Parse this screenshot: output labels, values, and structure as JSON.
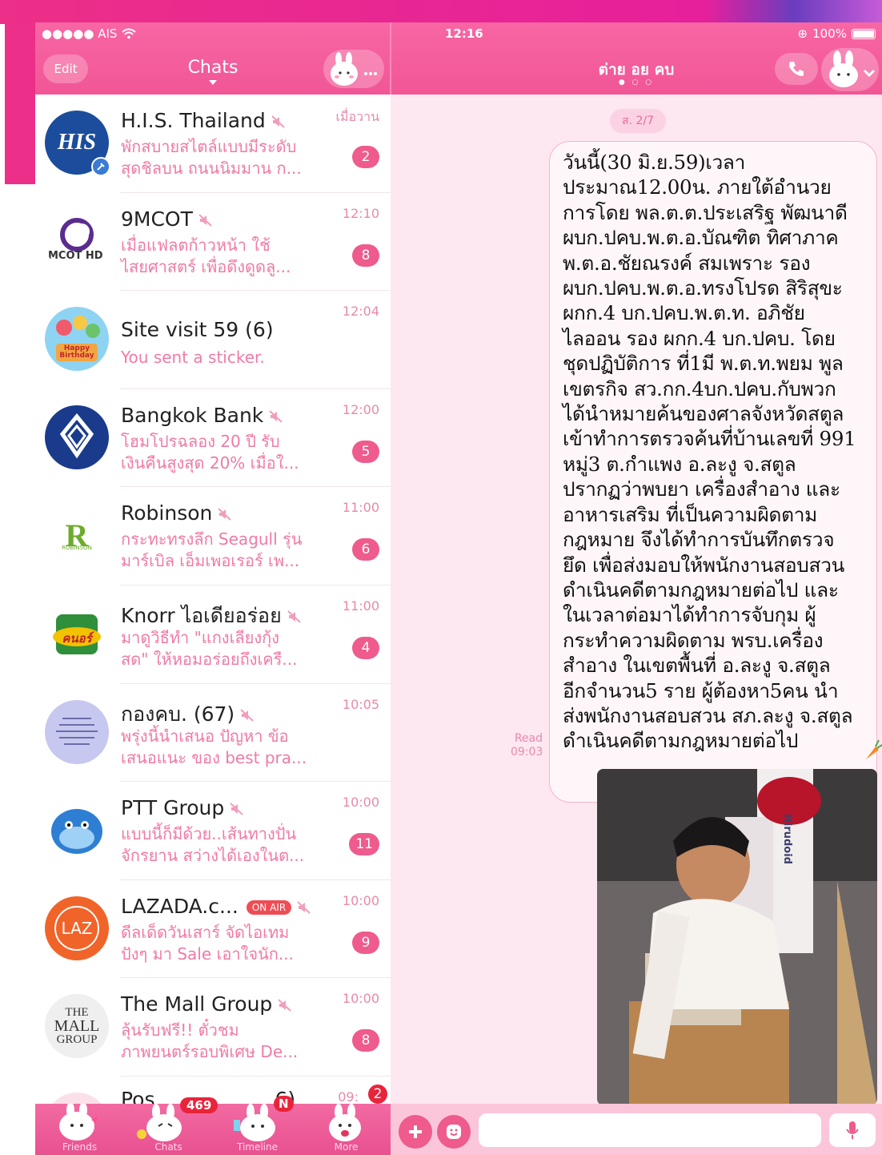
{
  "status_bar": {
    "carrier": "●●●●● AIS",
    "time": "12:16",
    "battery": "100%"
  },
  "left_header": {
    "edit_label": "Edit",
    "title": "Chats"
  },
  "chats": [
    {
      "name": "H.I.S. Thailand",
      "muted": true,
      "preview": "พักสบายสไตล์แบบมีระดับ\nสุดชิลบน ถนนนิมมาน ก...",
      "time": "เมื่อวาน",
      "badge": "2"
    },
    {
      "name": "9MCOT",
      "muted": true,
      "preview": "เมื่อแฟลตก้าวหน้า ใช้\nไสยศาสตร์ เพื่อดึงดูดลู...",
      "time": "12:10",
      "badge": "8"
    },
    {
      "name": "Site visit 59 (6)",
      "muted": false,
      "preview": "You sent a sticker.",
      "time": "12:04",
      "badge": ""
    },
    {
      "name": "Bangkok Bank",
      "muted": true,
      "preview": "โฮมโปรฉลอง 20 ปี  รับ\nเงินคืนสูงสุด 20% เมื่อใ...",
      "time": "12:00",
      "badge": "5"
    },
    {
      "name": "Robinson",
      "muted": true,
      "preview": "กระทะทรงลึก Seagull รุ่น\nมาร์เบิล เอ็มเพอเรอร์ เพ...",
      "time": "11:00",
      "badge": "6"
    },
    {
      "name": "Knorr ไอเดียอร่อย",
      "muted": true,
      "preview": "มาดูวิธีทำ \"แกงเลียงกุ้ง\nสด\" ให้หอมอร่อยถึงเครื...",
      "time": "11:00",
      "badge": "4"
    },
    {
      "name": "กองคบ. (67)",
      "muted": true,
      "preview": "พรุ่งนี้นำเสนอ ปัญหา ข้อ\nเสนอแนะ ของ best pra...",
      "time": "10:05",
      "badge": ""
    },
    {
      "name": "PTT Group",
      "muted": true,
      "preview": "แบบนี้ก็มีด้วย..เส้นทางปั่น\nจักรยาน สว่างได้เองในต...",
      "time": "10:00",
      "badge": "11"
    },
    {
      "name": "LAZADA.c...",
      "muted": true,
      "onair": "ON AIR",
      "preview": "ดีลเด็ดวันเสาร์ จัดไอเทม\nปังๆ มา Sale  เอาใจนัก...",
      "time": "10:00",
      "badge": "9"
    },
    {
      "name": "The Mall Group",
      "muted": true,
      "preview": "ลุ้นรับฟรี!! ตั๋วชม\nภาพยนตร์รอบพิเศษ De...",
      "time": "10:00",
      "badge": "8"
    }
  ],
  "partial_row": {
    "name": "Pos",
    "name_tail": "6)",
    "time": "09:",
    "badge": "2"
  },
  "avatars": {
    "his": "HIS",
    "mcot": "MCOT HD",
    "robinson": "R",
    "robinson_sub": "ROBINSON",
    "knorr": "คนอร์",
    "mall": [
      "THE",
      "MALL",
      "GROUP"
    ],
    "lazada": "LAZ",
    "birthday": "Happy Birthday"
  },
  "tabbar": {
    "tabs": [
      {
        "label": "Friends"
      },
      {
        "label": "Chats",
        "badge": "469"
      },
      {
        "label": "Timeline",
        "badge": "N"
      },
      {
        "label": "More"
      }
    ]
  },
  "room": {
    "title": "ต่าย อย คบ",
    "date_chip": "ส. 2/7",
    "message": "วันนี้(30 มิ.ย.59)เวลา\nประมาณ12.00น. ภายใต้อำนวย\nการโดย พล.ต.ต.ประเสริฐ พัฒนาดี\nผบก.ปคบ.พ.ต.อ.บัณฑิต ทิศาภาค\nพ.ต.อ.ชัยณรงค์ สมเพราะ รอง\nผบก.ปคบ.พ.ต.อ.ทรงโปรด สิริสุขะ\nผกก.4  บก.ปคบ.พ.ต.ท. อภิชัย\nไลออน  รอง ผกก.4 บก.ปคบ. โดย\nชุดปฏิบัติการ ที่1มี พ.ต.ท.พยม พูล\nเขตรกิจ สว.กก.4บก.ปคบ.กับพวก\nได้นำหมายค้นของศาลจังหวัดสตูล\nเข้าทำการตรวจค้นที่บ้านเลขที่  991\nหมู่3 ต.กำแพง อ.ละงู จ.สตูล\nปรากฏว่าพบยา  เครื่องสำอาง และ\nอาหารเสริม ที่เป็นความผิดตาม\nกฎหมาย จึงได้ทำการบันทึกตรวจ\nยึด เพื่อส่งมอบให้พนักงานสอบสวน\nดำเนินคดีตามกฎหมายต่อไป   และ\nในเวลาต่อมาได้ทำการจับกุม  ผู้\nกระทำความผิดตาม พรบ.เครื่อง\nสำอาง ในเขตพื้นที่ อ.ละงู จ.สตูล\nอีกจำนวน5 ราย ผู้ต้องหา5คน  นำ\nส่งพนักงานสอบสวน สภ.ละงู จ.สตูล\nดำเนินคดีตามกฎหมายต่อไป",
    "read_label": "Read",
    "read_time": "09:03",
    "photo_box_text": "Hirudoid"
  },
  "input": {
    "placeholder": ""
  },
  "colors": {
    "accent": "#ee5b8c",
    "header": "#f25c97",
    "preview_text": "#f07aa6",
    "chat_bg": "#fde7f0"
  }
}
